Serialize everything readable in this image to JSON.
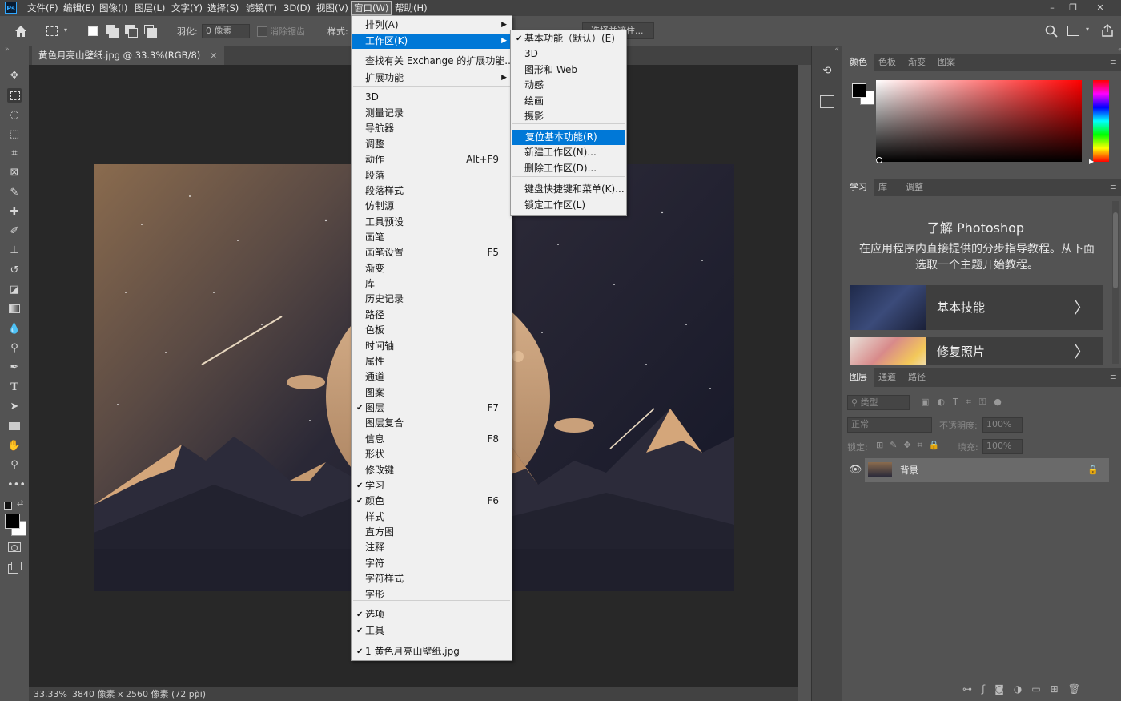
{
  "app": {
    "logo": "Ps"
  },
  "menubar": [
    {
      "label": "文件(F)"
    },
    {
      "label": "编辑(E)"
    },
    {
      "label": "图像(I)"
    },
    {
      "label": "图层(L)"
    },
    {
      "label": "文字(Y)"
    },
    {
      "label": "选择(S)"
    },
    {
      "label": "滤镜(T)"
    },
    {
      "label": "3D(D)"
    },
    {
      "label": "视图(V)"
    },
    {
      "label": "窗口(W)"
    },
    {
      "label": "帮助(H)"
    }
  ],
  "window_buttons": {
    "minimize": "–",
    "restore": "❐",
    "close": "✕"
  },
  "options": {
    "feather_label": "羽化:",
    "feather_value": "0 像素",
    "antialias_label": "消除锯齿",
    "style_label": "样式:",
    "select_mask_label": "选择并遮住..."
  },
  "document": {
    "tab_label": "黄色月亮山壁纸.jpg @ 33.3%(RGB/8)",
    "tab_close": "×",
    "zoom": "33.33%",
    "info": "3840 像素 x 2560 像素 (72 ppi)",
    "info_arrow": "〉"
  },
  "colors": {
    "accent": "#0078d7",
    "sky_top": "#8b6a4c",
    "night": "#1c1d2e",
    "moon": "#c9a07a"
  },
  "window_menu": {
    "items": [
      {
        "label": "排列(A)",
        "checked": false,
        "shortcut": "",
        "submenu": true
      },
      {
        "label": "工作区(K)",
        "checked": false,
        "shortcut": "",
        "submenu": true,
        "highlighted": true
      },
      {
        "label": "查找有关 Exchange 的扩展功能...",
        "checked": false,
        "shortcut": "",
        "submenu": false
      },
      {
        "label": "扩展功能",
        "checked": false,
        "shortcut": "",
        "submenu": true
      },
      {
        "label": "3D",
        "checked": false,
        "shortcut": "",
        "submenu": false
      },
      {
        "label": "测量记录",
        "checked": false,
        "shortcut": "",
        "submenu": false
      },
      {
        "label": "导航器",
        "checked": false,
        "shortcut": "",
        "submenu": false
      },
      {
        "label": "调整",
        "checked": false,
        "shortcut": "",
        "submenu": false
      },
      {
        "label": "动作",
        "checked": false,
        "shortcut": "Alt+F9",
        "submenu": false
      },
      {
        "label": "段落",
        "checked": false,
        "shortcut": "",
        "submenu": false
      },
      {
        "label": "段落样式",
        "checked": false,
        "shortcut": "",
        "submenu": false
      },
      {
        "label": "仿制源",
        "checked": false,
        "shortcut": "",
        "submenu": false
      },
      {
        "label": "工具预设",
        "checked": false,
        "shortcut": "",
        "submenu": false
      },
      {
        "label": "画笔",
        "checked": false,
        "shortcut": "",
        "submenu": false
      },
      {
        "label": "画笔设置",
        "checked": false,
        "shortcut": "F5",
        "submenu": false
      },
      {
        "label": "渐变",
        "checked": false,
        "shortcut": "",
        "submenu": false
      },
      {
        "label": "库",
        "checked": false,
        "shortcut": "",
        "submenu": false
      },
      {
        "label": "历史记录",
        "checked": false,
        "shortcut": "",
        "submenu": false
      },
      {
        "label": "路径",
        "checked": false,
        "shortcut": "",
        "submenu": false
      },
      {
        "label": "色板",
        "checked": false,
        "shortcut": "",
        "submenu": false
      },
      {
        "label": "时间轴",
        "checked": false,
        "shortcut": "",
        "submenu": false
      },
      {
        "label": "属性",
        "checked": false,
        "shortcut": "",
        "submenu": false
      },
      {
        "label": "通道",
        "checked": false,
        "shortcut": "",
        "submenu": false
      },
      {
        "label": "图案",
        "checked": false,
        "shortcut": "",
        "submenu": false
      },
      {
        "label": "图层",
        "checked": true,
        "shortcut": "F7",
        "submenu": false
      },
      {
        "label": "图层复合",
        "checked": false,
        "shortcut": "",
        "submenu": false
      },
      {
        "label": "信息",
        "checked": false,
        "shortcut": "F8",
        "submenu": false
      },
      {
        "label": "形状",
        "checked": false,
        "shortcut": "",
        "submenu": false
      },
      {
        "label": "修改键",
        "checked": false,
        "shortcut": "",
        "submenu": false
      },
      {
        "label": "学习",
        "checked": true,
        "shortcut": "",
        "submenu": false
      },
      {
        "label": "颜色",
        "checked": true,
        "shortcut": "F6",
        "submenu": false
      },
      {
        "label": "样式",
        "checked": false,
        "shortcut": "",
        "submenu": false
      },
      {
        "label": "直方图",
        "checked": false,
        "shortcut": "",
        "submenu": false
      },
      {
        "label": "注释",
        "checked": false,
        "shortcut": "",
        "submenu": false
      },
      {
        "label": "字符",
        "checked": false,
        "shortcut": "",
        "submenu": false
      },
      {
        "label": "字符样式",
        "checked": false,
        "shortcut": "",
        "submenu": false
      },
      {
        "label": "字形",
        "checked": false,
        "shortcut": "",
        "submenu": false
      },
      {
        "label": "选项",
        "checked": true,
        "shortcut": "",
        "submenu": false
      },
      {
        "label": "工具",
        "checked": true,
        "shortcut": "",
        "submenu": false
      },
      {
        "label": "1 黄色月亮山壁纸.jpg",
        "checked": true,
        "shortcut": "",
        "submenu": false
      }
    ],
    "check_glyph": "✔",
    "arrow_glyph": "▶"
  },
  "workspace_menu": {
    "items": [
      {
        "label": "基本功能（默认）(E)",
        "checked": true
      },
      {
        "label": "3D",
        "checked": false
      },
      {
        "label": "图形和 Web",
        "checked": false
      },
      {
        "label": "动感",
        "checked": false
      },
      {
        "label": "绘画",
        "checked": false
      },
      {
        "label": "摄影",
        "checked": false
      },
      {
        "label": "复位基本功能(R)",
        "checked": false,
        "highlighted": true
      },
      {
        "label": "新建工作区(N)...",
        "checked": false
      },
      {
        "label": "删除工作区(D)...",
        "checked": false
      },
      {
        "label": "键盘快捷键和菜单(K)...",
        "checked": false
      },
      {
        "label": "锁定工作区(L)",
        "checked": false
      }
    ]
  },
  "color_panel": {
    "tabs": [
      "颜色",
      "色板",
      "渐变",
      "图案"
    ]
  },
  "learn_panel": {
    "tabs": [
      "学习",
      "库",
      "调整"
    ],
    "title": "了解 Photoshop",
    "description": "在应用程序内直接提供的分步指导教程。从下面选取一个主题开始教程。",
    "cards": [
      {
        "label": "基本技能",
        "chevron": "〉"
      },
      {
        "label": "修复照片",
        "chevron": "〉"
      }
    ]
  },
  "layers_panel": {
    "tabs": [
      "图层",
      "通道",
      "路径"
    ],
    "filter_placeholder": "类型",
    "blend_mode": "正常",
    "opacity_label": "不透明度:",
    "opacity_value": "100%",
    "lock_label": "锁定:",
    "fill_label": "填充:",
    "fill_value": "100%",
    "layers": [
      {
        "name": "背景",
        "visible": true,
        "locked": true
      }
    ]
  }
}
